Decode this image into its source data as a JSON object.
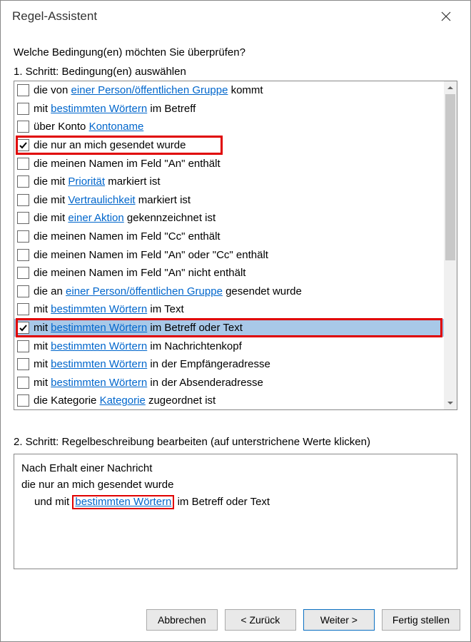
{
  "window": {
    "title": "Regel-Assistent"
  },
  "question": "Welche Bedingung(en) möchten Sie überprüfen?",
  "step1_label": "1. Schritt: Bedingung(en) auswählen",
  "step2_label": "2. Schritt: Regelbeschreibung bearbeiten (auf unterstrichene Werte klicken)",
  "conditions": [
    {
      "checked": false,
      "selected": false,
      "parts": [
        {
          "t": "die von "
        },
        {
          "t": "einer Person/öffentlichen Gruppe",
          "link": true
        },
        {
          "t": " kommt"
        }
      ]
    },
    {
      "checked": false,
      "selected": false,
      "parts": [
        {
          "t": "mit "
        },
        {
          "t": "bestimmten Wörtern",
          "link": true
        },
        {
          "t": " im Betreff"
        }
      ]
    },
    {
      "checked": false,
      "selected": false,
      "parts": [
        {
          "t": "über Konto "
        },
        {
          "t": "Kontoname",
          "link": true
        }
      ]
    },
    {
      "checked": true,
      "selected": false,
      "red": true,
      "parts": [
        {
          "t": "die nur an mich gesendet wurde"
        }
      ]
    },
    {
      "checked": false,
      "selected": false,
      "parts": [
        {
          "t": "die meinen Namen im Feld \"An\" enthält"
        }
      ]
    },
    {
      "checked": false,
      "selected": false,
      "parts": [
        {
          "t": "die mit "
        },
        {
          "t": "Priorität",
          "link": true
        },
        {
          "t": " markiert ist"
        }
      ]
    },
    {
      "checked": false,
      "selected": false,
      "parts": [
        {
          "t": "die mit "
        },
        {
          "t": "Vertraulichkeit",
          "link": true
        },
        {
          "t": " markiert ist"
        }
      ]
    },
    {
      "checked": false,
      "selected": false,
      "parts": [
        {
          "t": "die mit "
        },
        {
          "t": "einer Aktion",
          "link": true
        },
        {
          "t": " gekennzeichnet ist"
        }
      ]
    },
    {
      "checked": false,
      "selected": false,
      "parts": [
        {
          "t": "die meinen Namen im Feld \"Cc\" enthält"
        }
      ]
    },
    {
      "checked": false,
      "selected": false,
      "parts": [
        {
          "t": "die meinen Namen im Feld \"An\" oder \"Cc\" enthält"
        }
      ]
    },
    {
      "checked": false,
      "selected": false,
      "parts": [
        {
          "t": "die meinen Namen im Feld \"An\" nicht enthält"
        }
      ]
    },
    {
      "checked": false,
      "selected": false,
      "parts": [
        {
          "t": "die an "
        },
        {
          "t": "einer Person/öffentlichen Gruppe",
          "link": true
        },
        {
          "t": " gesendet wurde"
        }
      ]
    },
    {
      "checked": false,
      "selected": false,
      "parts": [
        {
          "t": "mit "
        },
        {
          "t": "bestimmten Wörtern",
          "link": true
        },
        {
          "t": " im Text"
        }
      ]
    },
    {
      "checked": true,
      "selected": true,
      "red": true,
      "parts": [
        {
          "t": "mit "
        },
        {
          "t": "bestimmten Wörtern",
          "link": true
        },
        {
          "t": " im Betreff oder Text"
        }
      ]
    },
    {
      "checked": false,
      "selected": false,
      "parts": [
        {
          "t": "mit "
        },
        {
          "t": "bestimmten Wörtern",
          "link": true
        },
        {
          "t": " im Nachrichtenkopf"
        }
      ]
    },
    {
      "checked": false,
      "selected": false,
      "parts": [
        {
          "t": "mit "
        },
        {
          "t": "bestimmten Wörtern",
          "link": true
        },
        {
          "t": " in der Empfängeradresse"
        }
      ]
    },
    {
      "checked": false,
      "selected": false,
      "parts": [
        {
          "t": "mit "
        },
        {
          "t": "bestimmten Wörtern",
          "link": true
        },
        {
          "t": " in der Absenderadresse"
        }
      ]
    },
    {
      "checked": false,
      "selected": false,
      "parts": [
        {
          "t": "die Kategorie "
        },
        {
          "t": "Kategorie",
          "link": true
        },
        {
          "t": " zugeordnet ist"
        }
      ]
    }
  ],
  "description": {
    "line1": "Nach Erhalt einer Nachricht",
    "line2": "die nur an mich gesendet wurde",
    "line3_prefix": "und mit ",
    "line3_link": "bestimmten Wörtern",
    "line3_suffix": " im Betreff oder Text"
  },
  "buttons": {
    "cancel": "Abbrechen",
    "back": "<  Zurück",
    "next": "Weiter  >",
    "finish": "Fertig stellen"
  }
}
